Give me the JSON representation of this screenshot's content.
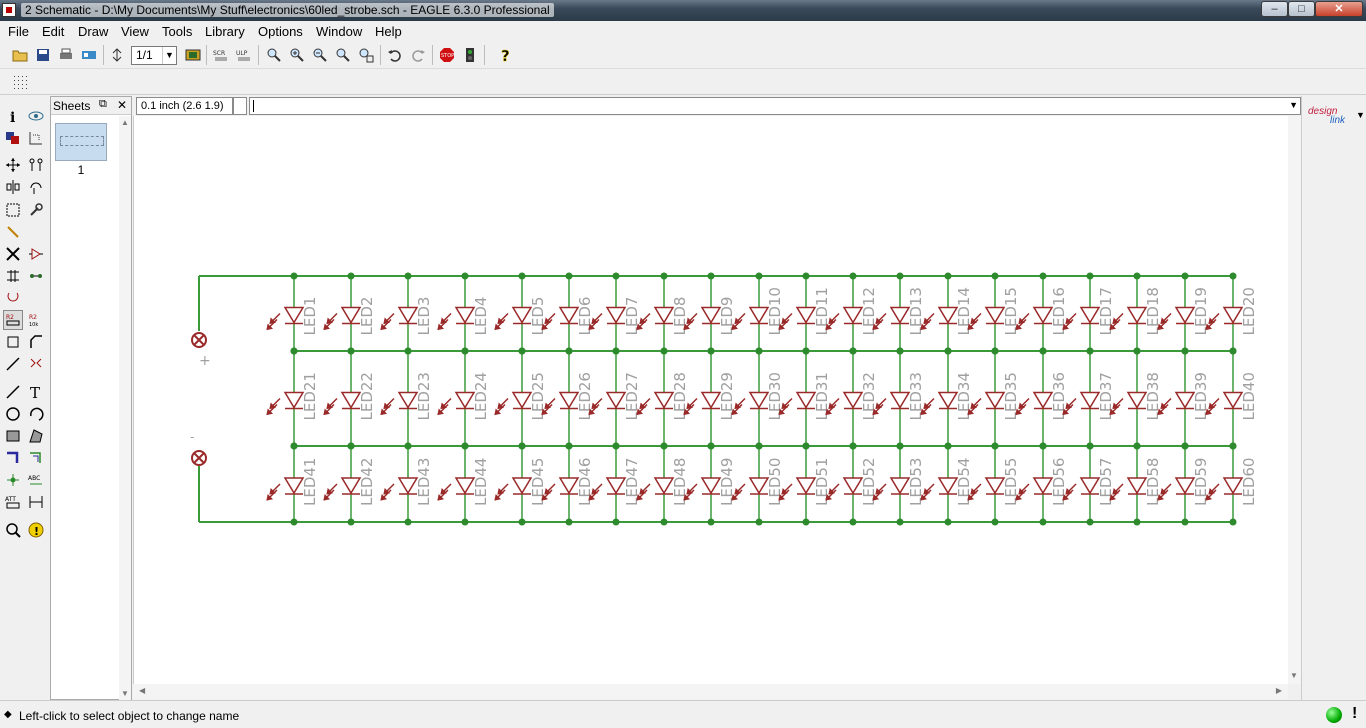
{
  "window": {
    "title": "2 Schematic - D:\\My Documents\\My Stuff\\electronics\\60led_strobe.sch - EAGLE 6.3.0 Professional",
    "min_label": "–",
    "max_label": "□",
    "close_label": "✕"
  },
  "menu": [
    "File",
    "Edit",
    "Draw",
    "View",
    "Tools",
    "Library",
    "Options",
    "Window",
    "Help"
  ],
  "toolbar": {
    "sheet_select": "1/1"
  },
  "sheets_panel": {
    "title": "Sheets",
    "sheet_number": "1"
  },
  "coordinates": "0.1 inch (2.6 1.9)",
  "command_line": "",
  "design_link": {
    "line1": "design",
    "line2": "link"
  },
  "status": {
    "message": "Left-click to select object to change name"
  },
  "schematic": {
    "plus_label": "+",
    "minus_label": "-",
    "rows": [
      [
        "LED1",
        "LED2",
        "LED3",
        "LED4",
        "LED5",
        "LED6",
        "LED7",
        "LED8",
        "LED9",
        "LED10",
        "LED11",
        "LED12",
        "LED13",
        "LED14",
        "LED15",
        "LED16",
        "LED17",
        "LED18",
        "LED19",
        "LED20"
      ],
      [
        "LED21",
        "LED22",
        "LED23",
        "LED24",
        "LED25",
        "LED26",
        "LED27",
        "LED28",
        "LED29",
        "LED30",
        "LED31",
        "LED32",
        "LED33",
        "LED34",
        "LED35",
        "LED36",
        "LED37",
        "LED38",
        "LED39",
        "LED40"
      ],
      [
        "LED41",
        "LED42",
        "LED43",
        "LED44",
        "LED45",
        "LED46",
        "LED47",
        "LED48",
        "LED49",
        "LED50",
        "LED51",
        "LED52",
        "LED53",
        "LED54",
        "LED55",
        "LED56",
        "LED57",
        "LED58",
        "LED59",
        "LED60"
      ]
    ],
    "colors": {
      "wire": "#3a9a3a",
      "junction": "#2d8a2d",
      "symbol": "#9a2a2a",
      "label": "#a0a0a0"
    }
  }
}
